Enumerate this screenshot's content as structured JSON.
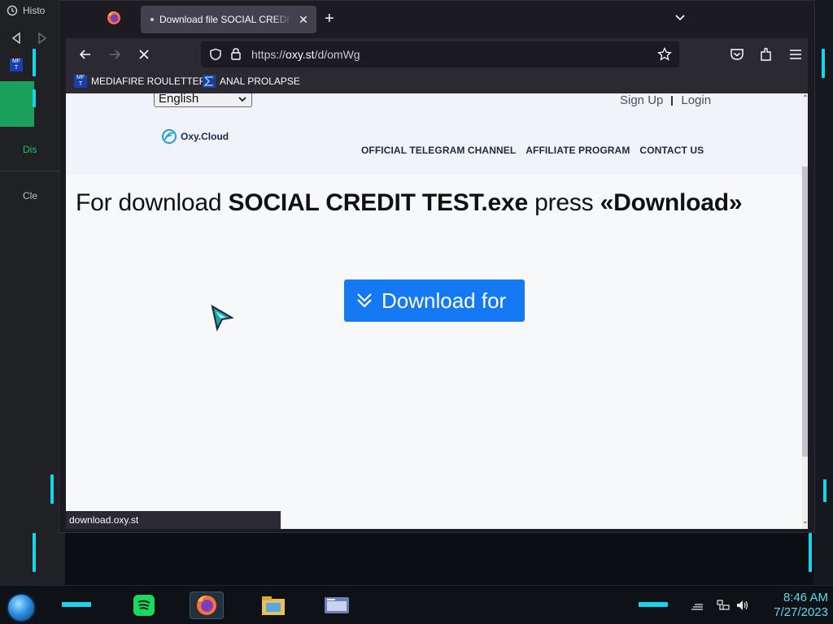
{
  "background_window": {
    "history_label": "Histo",
    "mft_badge": "MF\nT",
    "item_dis": "Dis",
    "item_cle": "Cle"
  },
  "browser": {
    "tab": {
      "title": "Download file SOCIAL CREDIT TEST.exe",
      "close_glyph": "✕"
    },
    "new_tab_glyph": "+",
    "url": {
      "prefix": "https://",
      "host": "oxy.st",
      "path": "/d/omWg"
    },
    "bookmarks": [
      {
        "label": "MEDIAFIRE ROULETTER",
        "icon": "mft-icon",
        "badge": "MF\nT"
      },
      {
        "label": "ANAL PROLAPSE",
        "icon": "sigma-icon"
      }
    ],
    "status_url": "download.oxy.st"
  },
  "page": {
    "language": "English",
    "auth": {
      "signup": "Sign Up",
      "login": "Login"
    },
    "logo_text": "Oxy.Cloud",
    "nav": [
      "OFFICIAL TELEGRAM CHANNEL",
      "AFFILIATE PROGRAM",
      "CONTACT US"
    ],
    "headline": {
      "pre": "For download ",
      "filename": "SOCIAL CREDIT TEST.exe",
      "mid": " press ",
      "action": "«Download»"
    },
    "download_button": "Download for"
  },
  "taskbar": {
    "time": "8:46 AM",
    "date": "7/27/2023",
    "apps": [
      "spotify-icon",
      "firefox-icon",
      "file-explorer-icon",
      "window-icon"
    ]
  },
  "colors": {
    "accent_button": "#1479f2",
    "clock_cyan": "#5fd8f0",
    "frame_cyan": "#19d4e8"
  }
}
